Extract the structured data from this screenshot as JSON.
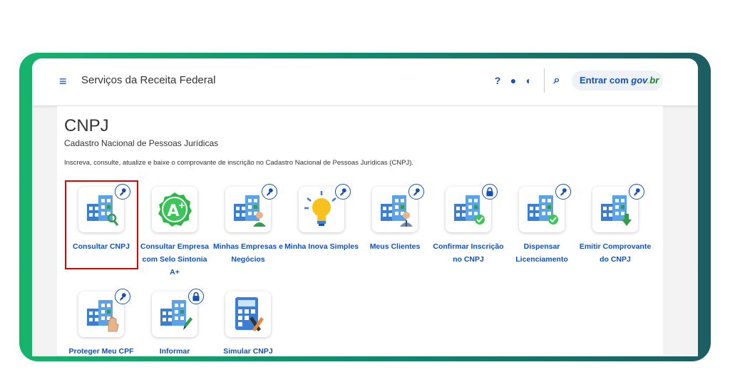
{
  "header": {
    "title": "Serviços da Receita Federal",
    "help_glyph": "?",
    "cookies_glyph": "●",
    "contrast_glyph": "◐",
    "search_glyph": "⌕",
    "menu_glyph": "≡",
    "login_text": "Entrar com",
    "gov_1": "gov",
    "gov_2": ".",
    "gov_3": "br"
  },
  "page": {
    "title": "CNPJ",
    "subtitle": "Cadastro Nacional de Pessoas Jurídicas",
    "description": "Inscreva, consulte, atualize e baixe o comprovante de inscrição no Cadastro Nacional de Pessoas Jurídicas (CNPJ)."
  },
  "services": [
    {
      "label": "Consultar CNPJ",
      "icon": "building-search-icon",
      "badge": "key-icon"
    },
    {
      "label": "Consultar Empresa com Selo Sintonia A+",
      "icon": "selo-a-plus-icon",
      "badge": ""
    },
    {
      "label": "Minhas Empresas e Negócios",
      "icon": "building-person-icon",
      "badge": "key-icon"
    },
    {
      "label": "Minha Inova Simples",
      "icon": "lightbulb-icon",
      "badge": "key-icon"
    },
    {
      "label": "Meus Clientes",
      "icon": "building-person-tie-icon",
      "badge": "key-icon"
    },
    {
      "label": "Confirmar Inscrição no CNPJ",
      "icon": "building-check-icon",
      "badge": "lock-icon"
    },
    {
      "label": "Dispensar Licenciamento",
      "icon": "building-check-icon",
      "badge": "key-icon"
    },
    {
      "label": "Emitir Comprovante do CNPJ",
      "icon": "building-download-icon",
      "badge": "key-icon"
    },
    {
      "label": "Proteger Meu CPF",
      "icon": "building-hand-icon",
      "badge": "key-icon"
    },
    {
      "label": "Informar",
      "icon": "building-pen-icon",
      "badge": "lock-icon"
    },
    {
      "label": "Simular CNPJ",
      "icon": "calculator-icon",
      "badge": ""
    }
  ],
  "colors": {
    "brand_blue": "#1351b4",
    "highlight_red": "#e00000",
    "frame_green": "#17b36b",
    "frame_teal": "#1b5e63"
  }
}
